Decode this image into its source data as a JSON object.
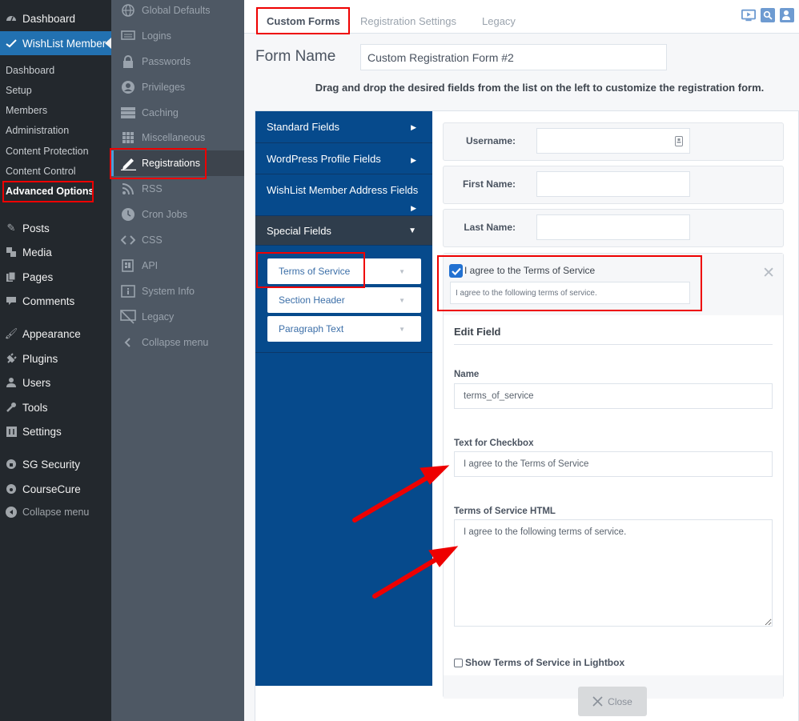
{
  "wp_menu": {
    "top": [
      {
        "label": "Dashboard",
        "icon": "dashboard-icon"
      },
      {
        "label": "WishList Member",
        "icon": "wishlist-check-icon",
        "active": true
      }
    ],
    "submenu": [
      "Dashboard",
      "Setup",
      "Members",
      "Administration",
      "Content Protection",
      "Content Control",
      "Advanced Options"
    ],
    "current_submenu": "Advanced Options",
    "items": [
      {
        "label": "Posts",
        "icon": "pushpin-icon"
      },
      {
        "label": "Media",
        "icon": "media-icon"
      },
      {
        "label": "Pages",
        "icon": "pages-icon"
      },
      {
        "label": "Comments",
        "icon": "comment-icon"
      },
      {
        "label": "Appearance",
        "icon": "paintbrush-icon"
      },
      {
        "label": "Plugins",
        "icon": "plugin-icon"
      },
      {
        "label": "Users",
        "icon": "user-icon"
      },
      {
        "label": "Tools",
        "icon": "wrench-icon"
      },
      {
        "label": "Settings",
        "icon": "settings-icon"
      },
      {
        "label": "SG Security",
        "icon": "lock-gear-icon"
      },
      {
        "label": "CourseCure",
        "icon": "coursecure-icon"
      }
    ],
    "collapse_label": "Collapse menu"
  },
  "wlm_menu": {
    "items": [
      {
        "label": "Global Defaults",
        "icon": "globe-icon"
      },
      {
        "label": "Logins",
        "icon": "monitor-icon"
      },
      {
        "label": "Passwords",
        "icon": "lock-icon"
      },
      {
        "label": "Privileges",
        "icon": "user-circle-icon"
      },
      {
        "label": "Caching",
        "icon": "server-icon"
      },
      {
        "label": "Miscellaneous",
        "icon": "grid-icon"
      },
      {
        "label": "Registrations",
        "icon": "pencil-icon",
        "active": true
      },
      {
        "label": "RSS",
        "icon": "rss-icon"
      },
      {
        "label": "Cron Jobs",
        "icon": "clock-icon"
      },
      {
        "label": "CSS",
        "icon": "code-icon"
      },
      {
        "label": "API",
        "icon": "api-icon"
      },
      {
        "label": "System Info",
        "icon": "info-icon"
      },
      {
        "label": "Legacy",
        "icon": "legacy-monitor-icon"
      }
    ],
    "collapse_label": "Collapse menu"
  },
  "tabs": [
    {
      "label": "Custom Forms",
      "active": true
    },
    {
      "label": "Registration Settings"
    },
    {
      "label": "Legacy"
    }
  ],
  "top_icons": [
    "video-icon",
    "search-doc-icon",
    "user-settings-icon"
  ],
  "form": {
    "name_label": "Form Name",
    "name_value": "Custom Registration Form #2",
    "instructions": "Drag and drop the desired fields from the list on the left to customize the registration form."
  },
  "field_categories": [
    {
      "label": "Standard Fields",
      "state": "collapsed"
    },
    {
      "label": "WordPress Profile Fields",
      "state": "collapsed"
    },
    {
      "label": "WishList Member Address Fields",
      "state": "collapsed"
    },
    {
      "label": "Special Fields",
      "state": "expanded"
    }
  ],
  "special_fields": [
    "Terms of Service",
    "Section Header",
    "Paragraph Text"
  ],
  "preview_fields": [
    {
      "label": "Username:",
      "value": ""
    },
    {
      "label": "First Name:",
      "value": ""
    },
    {
      "label": "Last Name:",
      "value": ""
    }
  ],
  "tos_preview": {
    "checked": true,
    "checkbox_text": "I agree to the Terms of Service",
    "terms_text": "I agree to the following terms of service."
  },
  "edit_field": {
    "title": "Edit Field",
    "name_label": "Name",
    "name_value": "terms_of_service",
    "checkbox_text_label": "Text for Checkbox",
    "checkbox_text_value": "I agree to the Terms of Service",
    "tos_html_label": "Terms of Service HTML",
    "tos_html_value": "I agree to the following terms of service.",
    "lightbox_label": "Show Terms of Service in Lightbox",
    "lightbox_checked": false,
    "close_label": "Close"
  },
  "colors": {
    "wp_sidebar": "#23282d",
    "wp_active": "#2271b1",
    "wlm_sidebar": "#4e5864",
    "field_list": "#064a8c",
    "annotation": "#ee0000"
  }
}
